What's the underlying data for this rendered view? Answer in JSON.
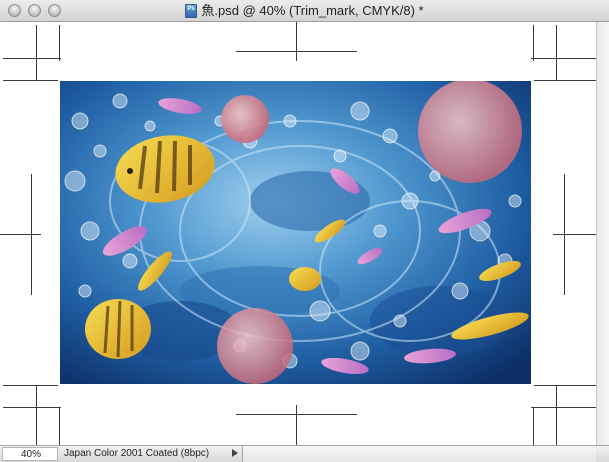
{
  "window": {
    "title": "魚.psd @ 40% (Trim_mark, CMYK/8) *",
    "file_icon": "photoshop-document-icon"
  },
  "statusbar": {
    "zoom": "40%",
    "profile": "Japan Color 2001 Coated (8bpc)"
  },
  "canvas": {
    "image": "underwater-fish-illustration"
  }
}
